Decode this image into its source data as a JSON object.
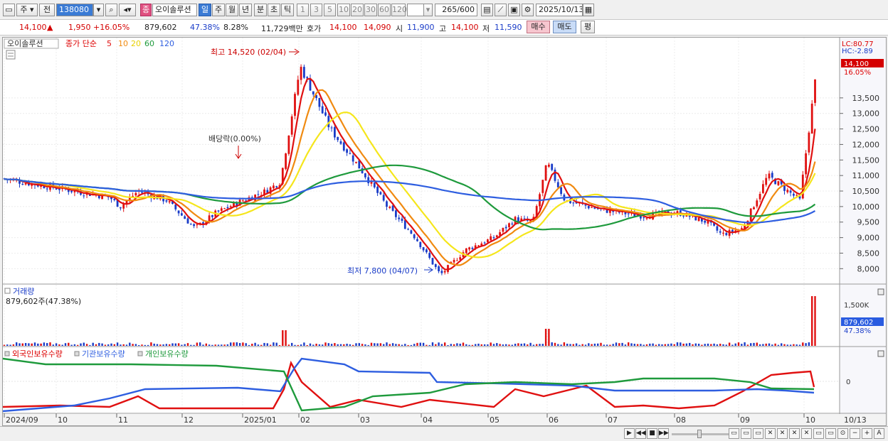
{
  "toolbar": {
    "market": "주",
    "prev": "전",
    "code": "138080",
    "badge": "종",
    "name": "오이솔루션",
    "periods": [
      "일",
      "주",
      "월",
      "년",
      "분",
      "초",
      "틱"
    ],
    "minutes": [
      "1",
      "3",
      "5",
      "10",
      "20",
      "30",
      "60",
      "120"
    ],
    "count": "265",
    "total": "/600",
    "date": "2025/10/13"
  },
  "quote": {
    "price": "14,100",
    "arrow": "▲",
    "change": "1,950",
    "change_pct": "+16.05%",
    "volume": "879,602",
    "vol_ratio": "47.38%",
    "turnover_pct": "8.28%",
    "amount": "11,729백만",
    "ask_label": "호가",
    "ask": "14,100",
    "bid": "14,090",
    "open_label": "시",
    "open": "11,900",
    "high_label": "고",
    "high": "14,100",
    "low_label": "저",
    "low": "11,590",
    "buy": "매수",
    "sell": "매도",
    "eval": "평"
  },
  "price_panel": {
    "stock_label": "오이솔루션",
    "ma_title": "종가 단순",
    "ma_periods": [
      "5",
      "10",
      "20",
      "60",
      "120"
    ],
    "ma_colors": [
      "#e01010",
      "#f08a10",
      "#f5e61b",
      "#1e9a3c",
      "#2e5ee0"
    ],
    "high_note": "최고 14,520 (02/04)",
    "low_note": "최저 7,800 (04/07)",
    "div_note": "배당락(0.00%)",
    "lc": "LC:80.77",
    "hc": "HC:-2.89",
    "last_price": "14,100",
    "last_pct": "16.05%"
  },
  "volume_panel": {
    "title": "거래량",
    "value_text": "879,602주(47.38%)",
    "axis_label": "1,500K",
    "last_value": "879,602",
    "last_pct": "47.38%"
  },
  "holder_panel": {
    "legend": [
      "외국인보유수량",
      "기관보유수량",
      "개인보유수량"
    ],
    "legend_colors": [
      "#e01010",
      "#2e5ee0",
      "#1e9a3c"
    ],
    "zero_label": "0"
  },
  "x_axis": [
    "2024/09",
    "10",
    "11",
    "12",
    "2025/01",
    "02",
    "03",
    "04",
    "05",
    "06",
    "07",
    "08",
    "09",
    "10",
    "10/13"
  ],
  "chart_data": {
    "type": "candlestick",
    "title": "오이솔루션",
    "y_ticks": [
      8000,
      8500,
      9000,
      9500,
      10000,
      10500,
      11000,
      11500,
      12000,
      12500,
      13000,
      13500
    ],
    "y_tick_labels": [
      "8,000",
      "8,500",
      "9,000",
      "9,500",
      "10,000",
      "10,500",
      "11,000",
      "11,500",
      "12,000",
      "12,500",
      "13,000",
      "13,500"
    ],
    "ylim": [
      7550,
      14800
    ],
    "close_path": [
      {
        "x": "2024/09",
        "y": 10900
      },
      {
        "x": "2024/10",
        "y": 10600
      },
      {
        "x": "2024/11",
        "y": 10300
      },
      {
        "x": "2024/11 mid",
        "y": 10000
      },
      {
        "x": "2024/11 end",
        "y": 10500
      },
      {
        "x": "2024/12",
        "y": 10200
      },
      {
        "x": "2024/12 mid",
        "y": 9300
      },
      {
        "x": "2024/12 end",
        "y": 9800
      },
      {
        "x": "2025/01",
        "y": 10200
      },
      {
        "x": "2025/01 mid",
        "y": 10500
      },
      {
        "x": "2025/01 end",
        "y": 10800
      },
      {
        "x": "2025/02/04",
        "y": 14520
      },
      {
        "x": "2025/02 mid",
        "y": 12500
      },
      {
        "x": "2025/03",
        "y": 11300
      },
      {
        "x": "2025/03 mid",
        "y": 10000
      },
      {
        "x": "2025/03 end",
        "y": 9000
      },
      {
        "x": "2025/04/07",
        "y": 7800
      },
      {
        "x": "2025/04 end",
        "y": 8600
      },
      {
        "x": "2025/05",
        "y": 9000
      },
      {
        "x": "2025/05 mid",
        "y": 9600
      },
      {
        "x": "2025/06",
        "y": 9500
      },
      {
        "x": "2025/06 early",
        "y": 11400
      },
      {
        "x": "2025/06 mid",
        "y": 10200
      },
      {
        "x": "2025/07",
        "y": 9900
      },
      {
        "x": "2025/07 mid",
        "y": 9700
      },
      {
        "x": "2025/08",
        "y": 9800
      },
      {
        "x": "2025/08 mid",
        "y": 9500
      },
      {
        "x": "2025/08 end",
        "y": 9100
      },
      {
        "x": "2025/09",
        "y": 9300
      },
      {
        "x": "2025/09 mid",
        "y": 11000
      },
      {
        "x": "2025/10",
        "y": 10200
      },
      {
        "x": "2025/10/13",
        "y": 14100
      }
    ]
  }
}
